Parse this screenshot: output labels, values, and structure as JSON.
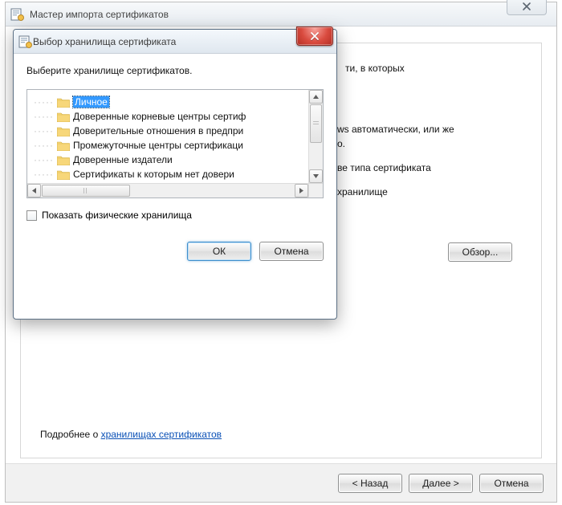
{
  "wizard": {
    "title": "Мастер импорта сертификатов",
    "body_line1": "ти, в которых",
    "body_line2": "ws автоматически, или же",
    "body_line3": "о.",
    "body_line4": "ве типа сертификата",
    "body_line5": "хранилище",
    "browse_button": "Обзор...",
    "link_prefix": "Подробнее о ",
    "link_text": "хранилищах сертификатов",
    "back_button": "< Назад",
    "next_button": "Далее >",
    "cancel_button": "Отмена"
  },
  "modal": {
    "title": "Выбор хранилища сертификата",
    "instruction": "Выберите хранилище сертификатов.",
    "items": [
      "Личное",
      "Доверенные корневые центры сертиф",
      "Доверительные отношения в предпри",
      "Промежуточные центры сертификаци",
      "Доверенные издатели",
      "Сертификаты  к которым нет довери"
    ],
    "selected_index": 0,
    "show_physical_label": "Показать физические хранилища",
    "ok_button": "ОК",
    "cancel_button": "Отмена"
  }
}
